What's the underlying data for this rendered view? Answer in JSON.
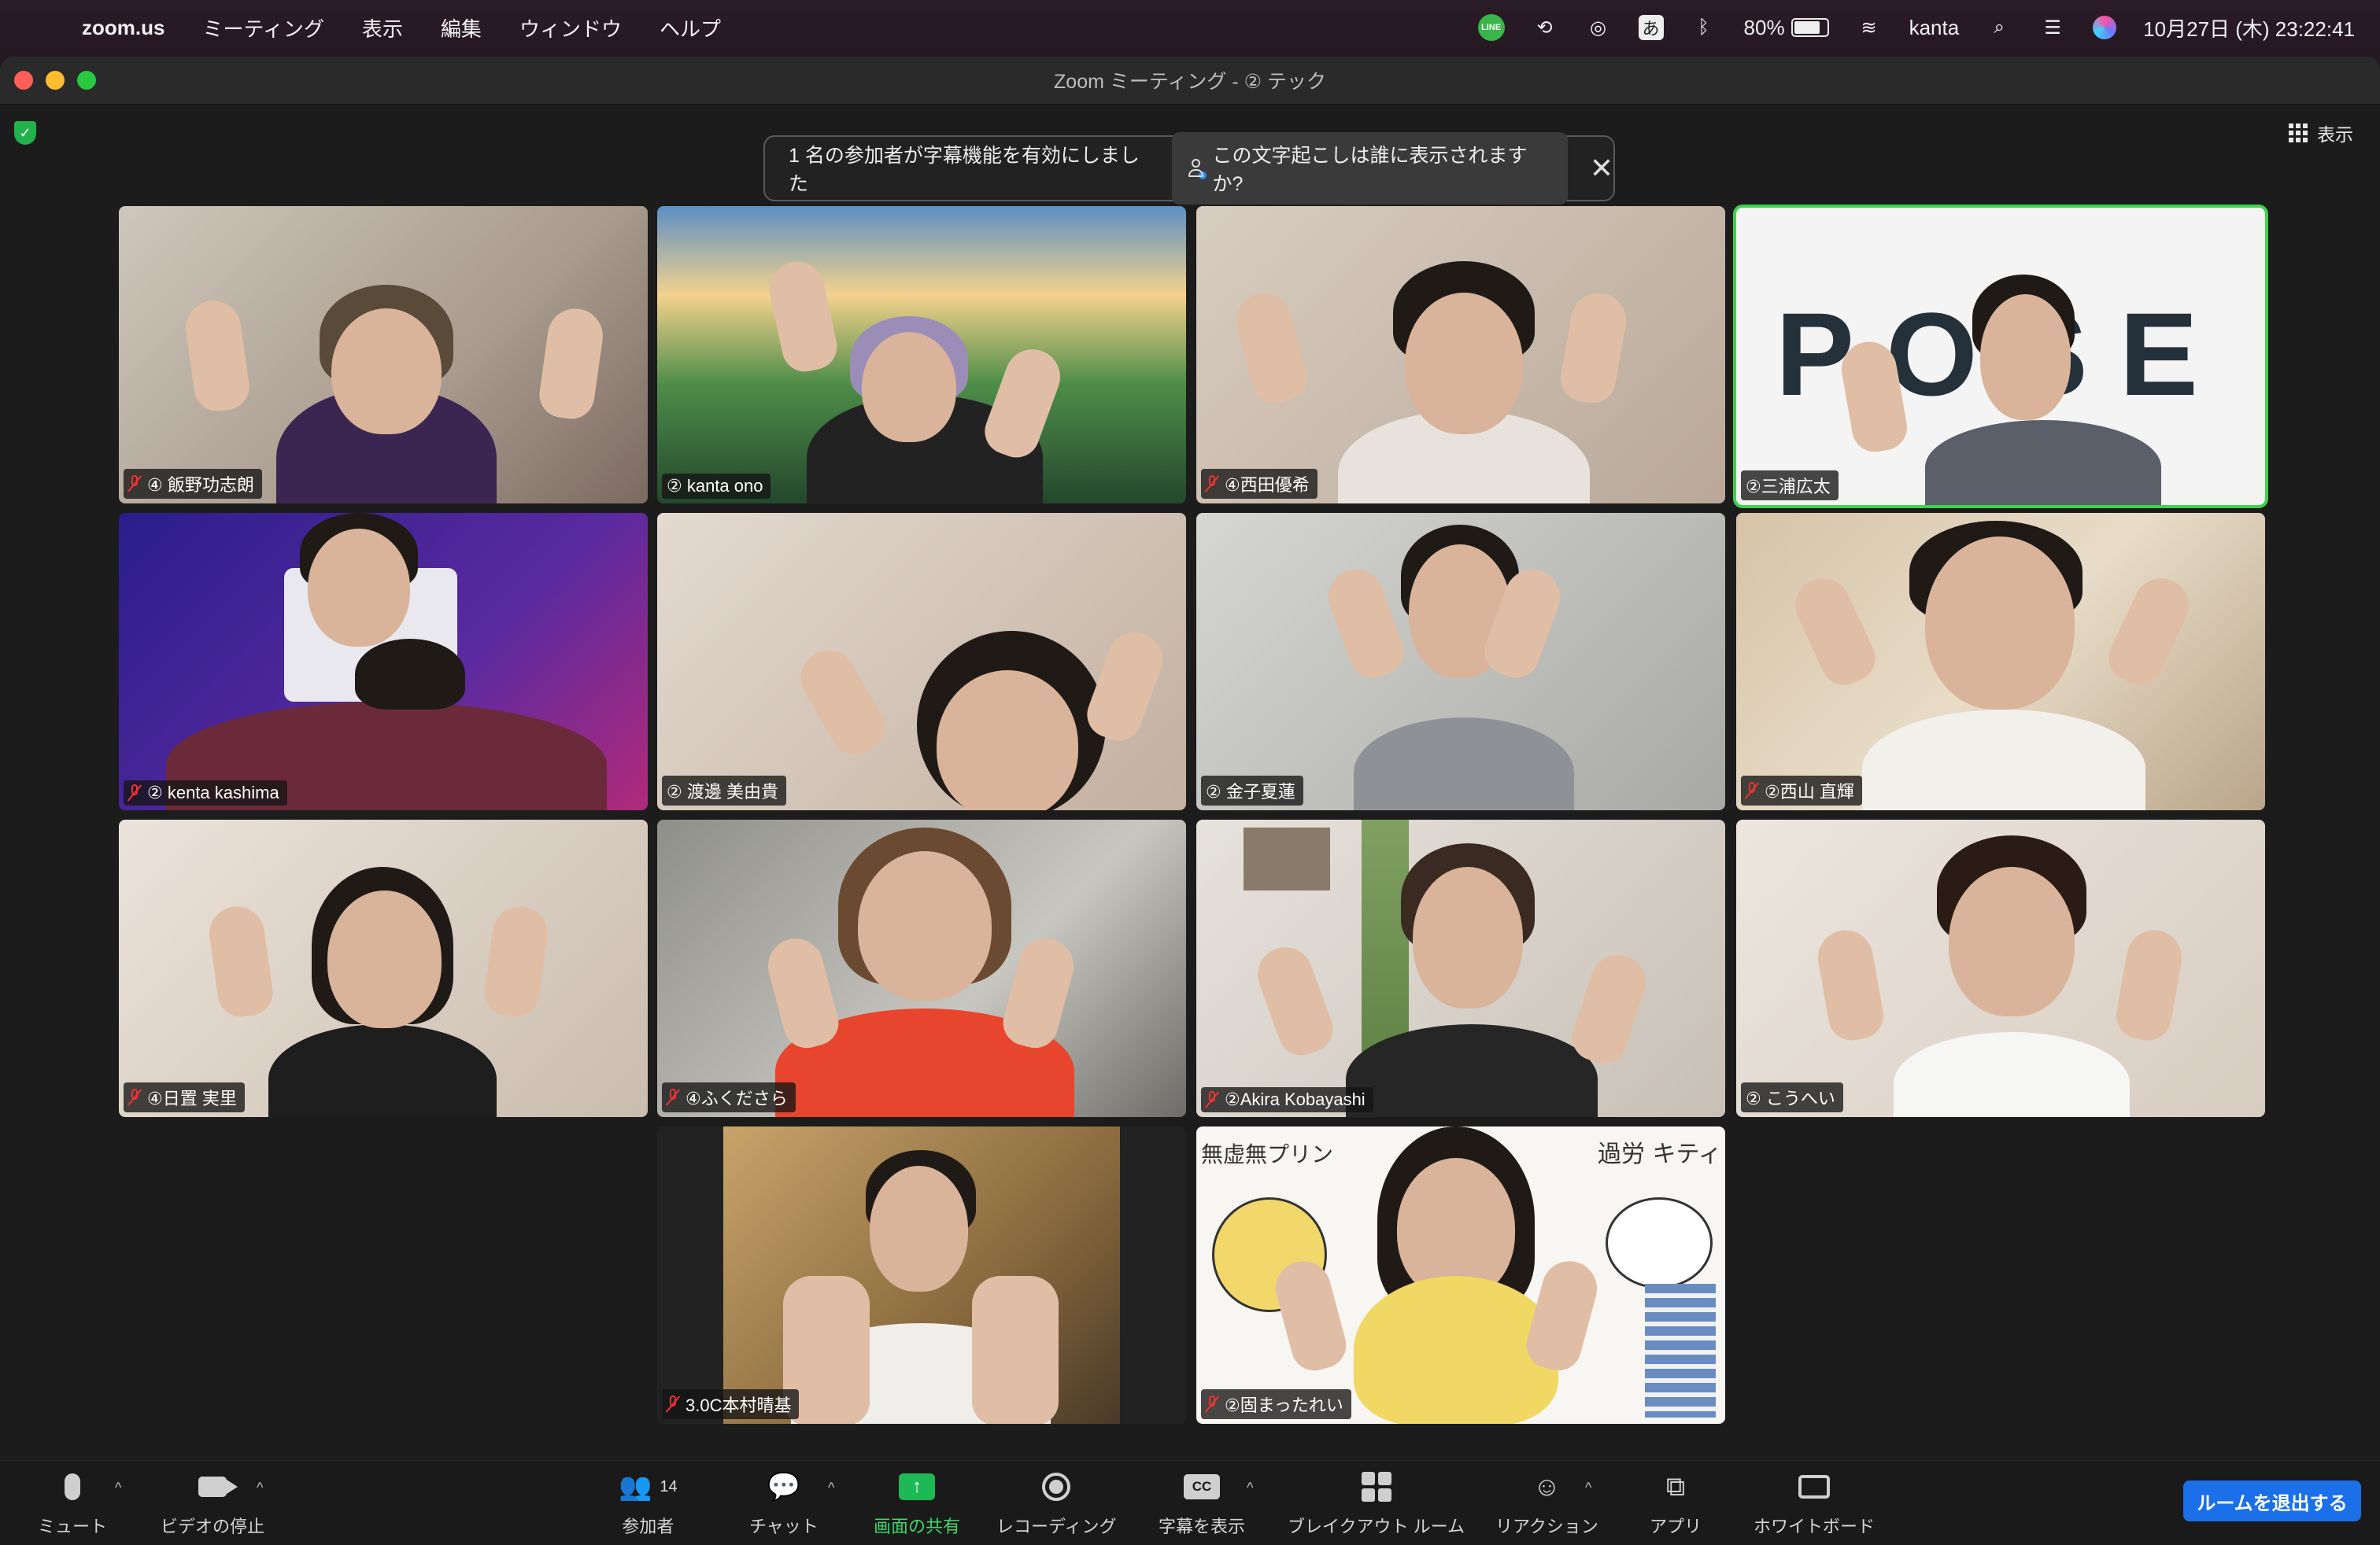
{
  "menubar": {
    "app": "zoom.us",
    "menus": [
      "ミーティング",
      "表示",
      "編集",
      "ウィンドウ",
      "ヘルプ"
    ],
    "status": {
      "battery": "80%",
      "user": "kanta",
      "datetime": "10月27日 (木)  23:22:41",
      "ime": "あ",
      "line_badge": "LINE"
    }
  },
  "window": {
    "title": "Zoom ミーティング - ② テック",
    "view_label": "表示"
  },
  "banner": {
    "message": "1 名の参加者が字幕機能を有効にしました",
    "link": "この文字起こしは誰に表示されますか?",
    "close": "✕"
  },
  "tiles": [
    {
      "name": "④ 飯野功志朗",
      "muted": true
    },
    {
      "name": "② kanta ono",
      "muted": false
    },
    {
      "name": "④西田優希",
      "muted": true
    },
    {
      "name": "②三浦広太",
      "muted": false,
      "active": true,
      "logo_text": "POSE"
    },
    {
      "name": "② kenta kashima",
      "muted": true
    },
    {
      "name": "② 渡邊 美由貴",
      "muted": false
    },
    {
      "name": "② 金子夏蓮",
      "muted": false
    },
    {
      "name": "②西山 直輝",
      "muted": true
    },
    {
      "name": "④日置 実里",
      "muted": true
    },
    {
      "name": "④ふくださら",
      "muted": true
    },
    {
      "name": "②Akira Kobayashi",
      "muted": true
    },
    {
      "name": "② こうへい",
      "muted": false
    },
    {
      "name": "3.0C本村晴基",
      "muted": true
    },
    {
      "name": "②固まったれい",
      "muted": true,
      "doodles": [
        "無虚無プリン",
        "過労 キティ"
      ]
    }
  ],
  "toolbar": {
    "mute": "ミュート",
    "video": "ビデオの停止",
    "participants": "参加者",
    "participants_count": "14",
    "chat": "チャット",
    "share": "画面の共有",
    "record": "レコーディング",
    "captions": "字幕を表示",
    "captions_icon": "CC",
    "breakout": "ブレイクアウト ルーム",
    "reactions": "リアクション",
    "apps": "アプリ",
    "whiteboard": "ホワイトボード",
    "leave": "ルームを退出する"
  },
  "colors": {
    "active_speaker": "#3dd34a",
    "share_green": "#1db954",
    "leave_blue": "#1b6fe8",
    "mute_red": "#ee3333"
  }
}
